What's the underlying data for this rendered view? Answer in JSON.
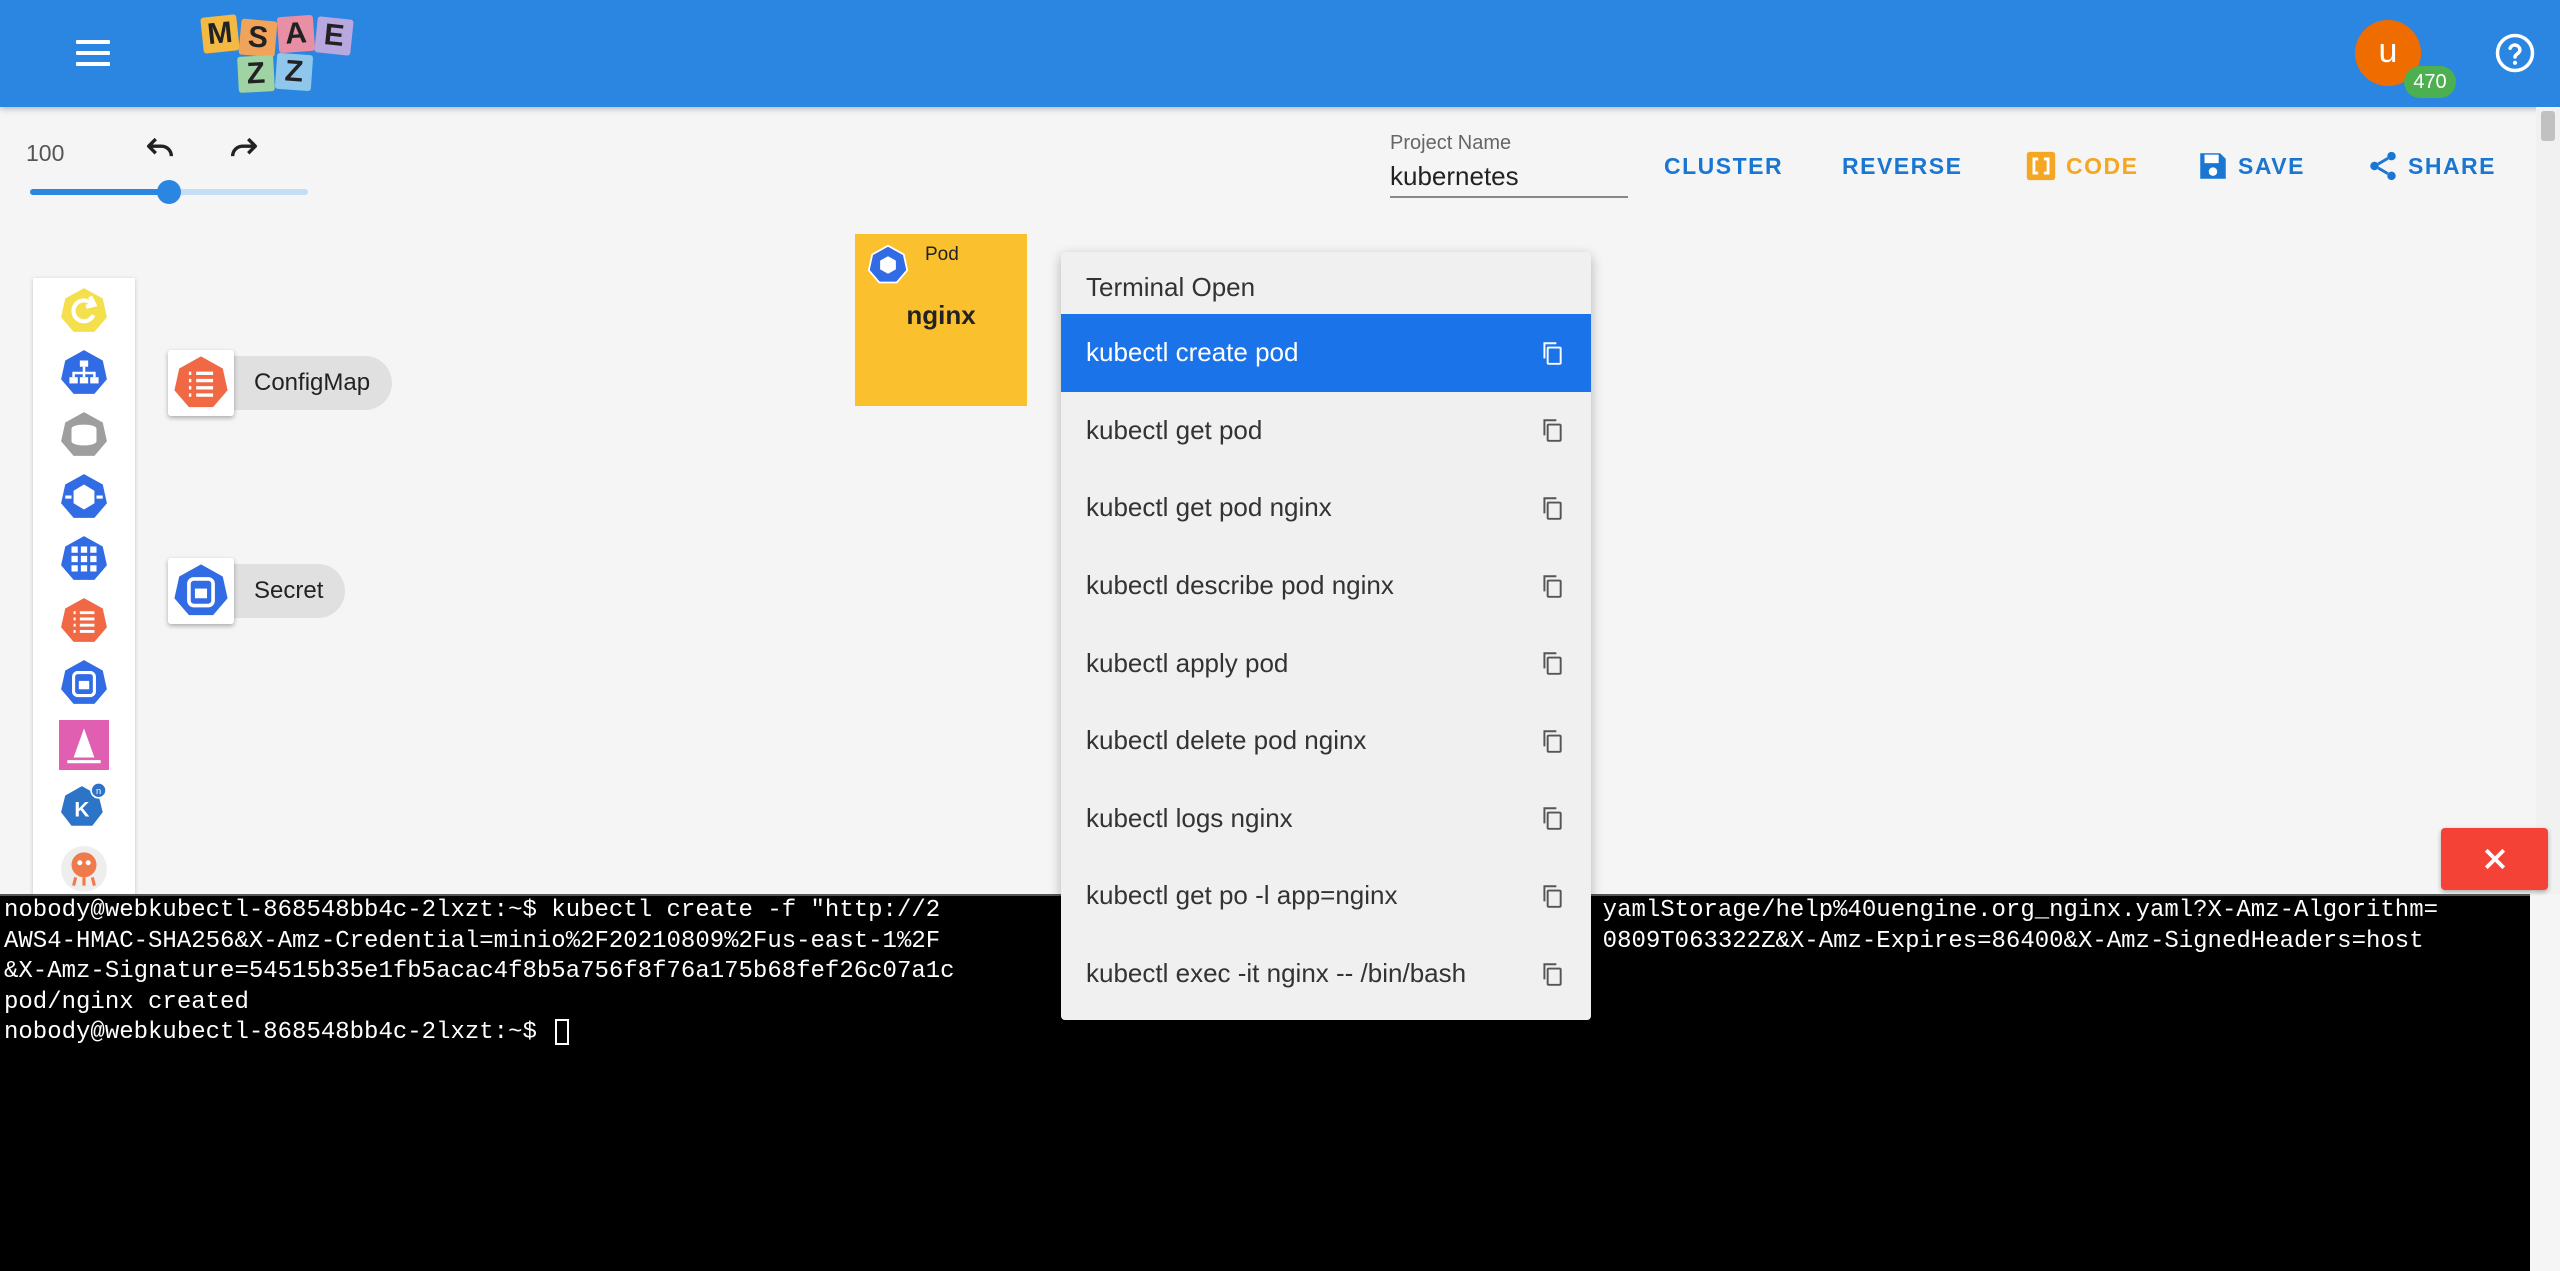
{
  "header": {
    "logo_letters": [
      "M",
      "S",
      "A",
      "E",
      "Z"
    ],
    "avatar_initial": "u",
    "avatar_badge": "470",
    "colors": {
      "appbar": "#2a86e0",
      "avatar": "#ef6c00",
      "badge": "#4caf50"
    }
  },
  "toolbar": {
    "zoom_value": "100",
    "zoom_level": 0.5,
    "project_label": "Project Name",
    "project_name": "kubernetes",
    "cluster_label": "CLUSTER",
    "reverse_label": "REVERSE",
    "code_label": "CODE",
    "save_label": "SAVE",
    "share_label": "SHARE"
  },
  "palette": {
    "icons": [
      "refresh-icon",
      "deployment-icon",
      "volume-icon",
      "service-icon",
      "replicaset-icon",
      "configmap-icon",
      "secret-icon",
      "helm-icon",
      "knative-icon",
      "argo-icon"
    ]
  },
  "canvas": {
    "configmap_label": "ConfigMap",
    "secret_label": "Secret",
    "pod": {
      "kind": "Pod",
      "name": "nginx",
      "color": "#fbc02d"
    }
  },
  "menu": {
    "title": "Terminal Open",
    "items": [
      {
        "label": "kubectl create pod",
        "active": true
      },
      {
        "label": "kubectl get pod"
      },
      {
        "label": "kubectl get pod nginx"
      },
      {
        "label": "kubectl describe pod nginx"
      },
      {
        "label": "kubectl apply pod"
      },
      {
        "label": "kubectl delete pod nginx"
      },
      {
        "label": "kubectl logs nginx"
      },
      {
        "label": "kubectl get po -l app=nginx"
      },
      {
        "label": "kubectl exec -it nginx -- /bin/bash"
      }
    ]
  },
  "terminal": {
    "lines": [
      "nobody@webkubectl-868548bb4c-2lxzt:~$ kubectl create -f \"http://2                                              yamlStorage/help%40uengine.org_nginx.yaml?X-Amz-Algorithm=",
      "AWS4-HMAC-SHA256&X-Amz-Credential=minio%2F20210809%2Fus-east-1%2F                                              0809T063322Z&X-Amz-Expires=86400&X-Amz-SignedHeaders=host",
      "&X-Amz-Signature=54515b35e1fb5acac4f8b5a756f8f76a175b68fef26c07a1c",
      "pod/nginx created",
      "nobody@webkubectl-868548bb4c-2lxzt:~$ "
    ]
  }
}
